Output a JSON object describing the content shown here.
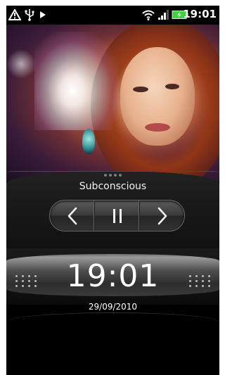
{
  "status_bar": {
    "time": "19:01",
    "icons": [
      "warning-icon",
      "usb-icon",
      "play-icon",
      "wifi-icon",
      "signal-icon",
      "battery-charging-icon"
    ],
    "battery_color": "#3fd13f"
  },
  "player": {
    "track_title": "Subconscious",
    "page_dots": 4,
    "controls": [
      "previous-icon",
      "pause-icon",
      "next-icon"
    ]
  },
  "clock": {
    "time": "19:01",
    "date": "29/09/2010"
  }
}
